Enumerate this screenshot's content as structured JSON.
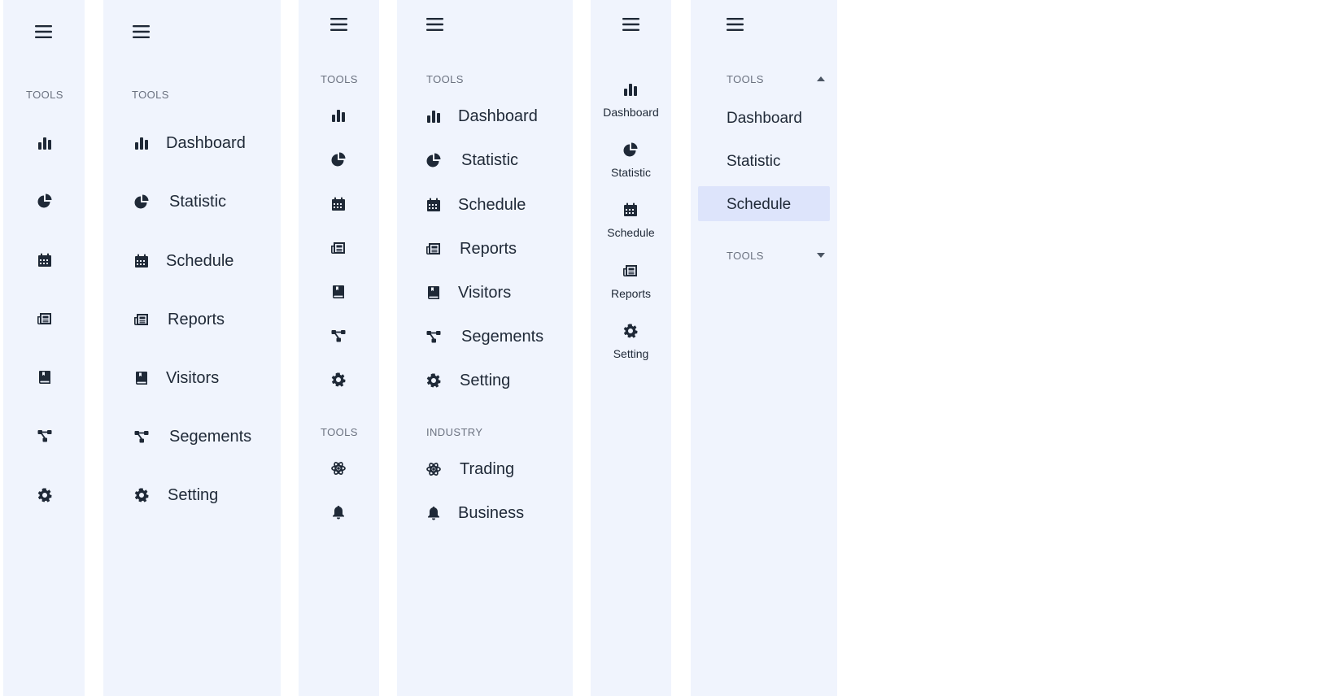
{
  "icons": [
    "menu-icon",
    "bar-chart-icon",
    "pie-chart-icon",
    "calendar-icon",
    "newspaper-icon",
    "book-icon",
    "network-icon",
    "gear-icon",
    "atom-icon",
    "bell-icon",
    "caret-up-icon",
    "caret-down-icon"
  ],
  "colors": {
    "panel_bg": "#f0f4fd",
    "text": "#1f2937",
    "section_label": "#6b7280",
    "active_bg": "#dde4fb"
  },
  "sidebar_1": {
    "section_label": "TOOLS"
  },
  "sidebar_2": {
    "section_label": "TOOLS",
    "items": [
      {
        "label": "Dashboard",
        "icon": "bar-chart-icon"
      },
      {
        "label": "Statistic",
        "icon": "pie-chart-icon"
      },
      {
        "label": "Schedule",
        "icon": "calendar-icon"
      },
      {
        "label": "Reports",
        "icon": "newspaper-icon"
      },
      {
        "label": "Visitors",
        "icon": "book-icon"
      },
      {
        "label": "Segements",
        "icon": "network-icon"
      },
      {
        "label": "Setting",
        "icon": "gear-icon"
      }
    ]
  },
  "sidebar_3": {
    "section_label_1": "TOOLS",
    "section_label_2": "TOOLS"
  },
  "sidebar_4": {
    "section_label": "TOOLS",
    "items": [
      {
        "label": "Dashboard",
        "icon": "bar-chart-icon"
      },
      {
        "label": "Statistic",
        "icon": "pie-chart-icon"
      },
      {
        "label": "Schedule",
        "icon": "calendar-icon"
      },
      {
        "label": "Reports",
        "icon": "newspaper-icon"
      },
      {
        "label": "Visitors",
        "icon": "book-icon"
      },
      {
        "label": "Segements",
        "icon": "network-icon"
      },
      {
        "label": "Setting",
        "icon": "gear-icon"
      }
    ],
    "section_label_2": "INDUSTRY",
    "items_2": [
      {
        "label": "Trading",
        "icon": "atom-icon"
      },
      {
        "label": "Business",
        "icon": "bell-icon"
      }
    ]
  },
  "sidebar_5": {
    "items": [
      {
        "label": "Dashboard",
        "icon": "bar-chart-icon"
      },
      {
        "label": "Statistic",
        "icon": "pie-chart-icon"
      },
      {
        "label": "Schedule",
        "icon": "calendar-icon"
      },
      {
        "label": "Reports",
        "icon": "newspaper-icon"
      },
      {
        "label": "Setting",
        "icon": "gear-icon"
      }
    ]
  },
  "sidebar_6": {
    "group_1": {
      "label": "TOOLS",
      "expanded": true,
      "items": [
        {
          "label": "Dashboard"
        },
        {
          "label": "Statistic"
        },
        {
          "label": "Schedule"
        }
      ],
      "active_item": "Schedule"
    },
    "group_2": {
      "label": "TOOLS",
      "expanded": false
    }
  }
}
